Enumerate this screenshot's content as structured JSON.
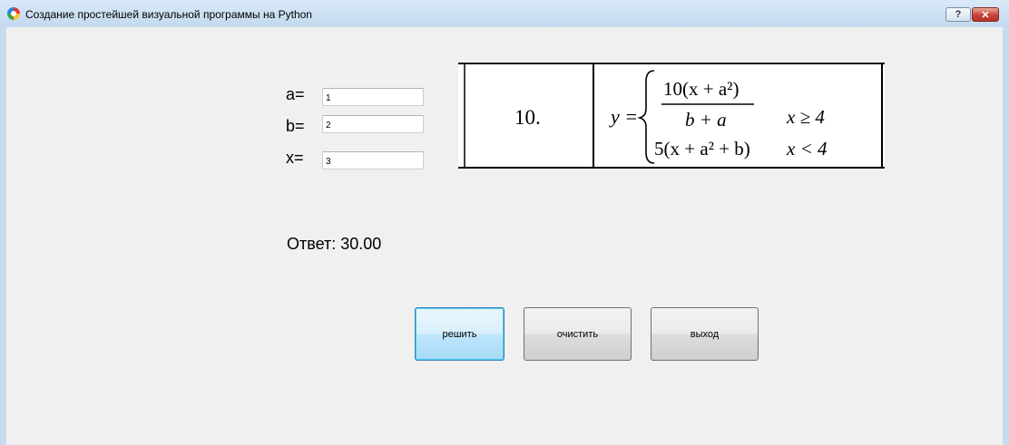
{
  "window": {
    "title": "Создание простейшей визуальной программы на Python",
    "help_label": "?",
    "close_label": "✕"
  },
  "inputs": {
    "a": {
      "label": "a=",
      "value": "1"
    },
    "b": {
      "label": "b=",
      "value": "2"
    },
    "x": {
      "label": "x=",
      "value": "3"
    }
  },
  "formula": {
    "number": "10.",
    "y_eq": "y =",
    "numerator": "10(x + a²)",
    "denominator": "b + a",
    "cond1": "x ≥ 4",
    "case2": "5(x + a² + b)",
    "cond2": "x < 4"
  },
  "answer": {
    "text": "Ответ: 30.00"
  },
  "buttons": {
    "solve": "решить",
    "clear": "очистить",
    "exit": "выход"
  }
}
